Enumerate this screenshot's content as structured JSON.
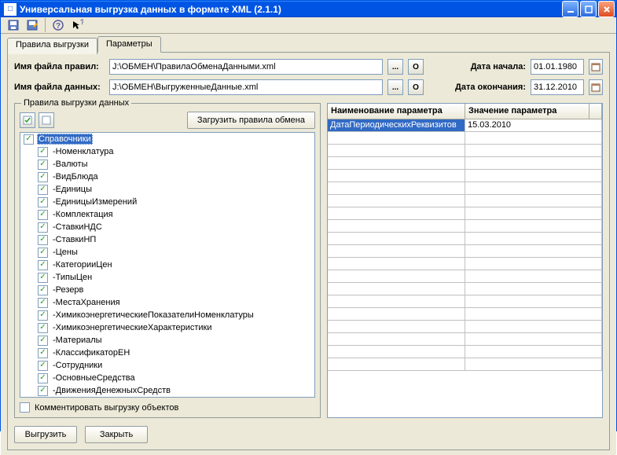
{
  "title": "Универсальная выгрузка данных в формате XML (2.1.1)",
  "tabs": {
    "rules": "Правила выгрузки",
    "params": "Параметры"
  },
  "labels": {
    "rules_file": "Имя файла правил:",
    "data_file": "Имя файла данных:",
    "start_date": "Дата начала:",
    "end_date": "Дата окончания:",
    "rules_group": "Правила выгрузки данных",
    "load_rules": "Загрузить правила обмена",
    "grid_param": "Наименование параметра",
    "grid_value": "Значение параметра",
    "comment_chk": "Комментировать выгрузку объектов",
    "export_btn": "Выгрузить",
    "close_btn": "Закрыть",
    "browse": "...",
    "o_btn": "O"
  },
  "fields": {
    "rules_file": "J:\\ОБМЕН\\ПравилаОбменаДанными.xml",
    "data_file": "J:\\ОБМЕН\\ВыгруженныеДанные.xml",
    "start_date": "01.01.1980",
    "end_date": "31.12.2010"
  },
  "tree": {
    "root": "Справочники",
    "children": [
      "Номенклатура",
      "Валюты",
      "ВидБлюда",
      "Единицы",
      "ЕдиницыИзмерений",
      "Комплектация",
      "СтавкиНДС",
      "СтавкиНП",
      "Цены",
      "КатегорииЦен",
      "ТипыЦен",
      "Резерв",
      "МестаХранения",
      "ХимикоэнергетическиеПоказателиНоменклатуры",
      "ХимикоэнергетическиеХарактеристики",
      "Материалы",
      "КлассификаторЕН",
      "Сотрудники",
      "ОсновныеСредства",
      "ДвиженияДенежныхСредств"
    ]
  },
  "grid_row": {
    "name": "ДатаПериодическихРеквизитов",
    "value": "15.03.2010"
  },
  "comment_checked": false
}
